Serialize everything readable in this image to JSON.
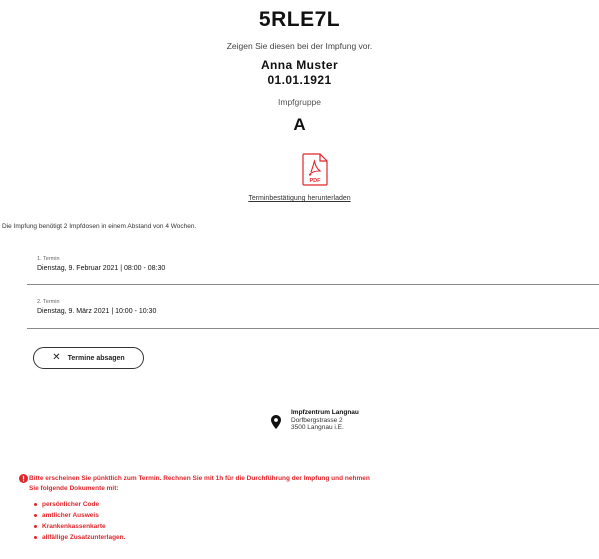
{
  "appointment": {
    "code": "5RLE7L",
    "code_hint": "Zeigen Sie diesen bei der Impfung vor.",
    "person_name": "Anna Muster",
    "birth_date": "01.01.1921",
    "group_label": "Impfgruppe",
    "group_value": "A"
  },
  "download": {
    "icon": "pdf-file-icon",
    "icon_text": "PDF",
    "link_label": "Terminbestätigung herunterladen"
  },
  "doses_info": "Die Impfung benötigt 2 Impfdosen in einem Abstand von 4 Wochen.",
  "termine": [
    {
      "label": "1. Termin",
      "datetime": "Dienstag, 9. Februar 2021 | 08:00 - 08:30"
    },
    {
      "label": "2. Termin",
      "datetime": "Dienstag, 9. März 2021 | 10:00 - 10:30"
    }
  ],
  "cancel_button": {
    "icon": "close-icon",
    "label": "Termine absagen"
  },
  "location": {
    "icon": "map-pin-icon",
    "name": "Impfzentrum Langnau",
    "street": "Dorfbergstrasse 2",
    "city": "3500 Langnau i.E."
  },
  "notice": {
    "icon": "alert-circle-icon",
    "color": "#e0262c",
    "text_line1": "Bitte erscheinen Sie pünktlich zum Termin. Rechnen Sie mit 1h für die Durchführung der Impfung und nehmen",
    "text_line2": "Sie folgende Dokumente mit:",
    "items": [
      "persönlicher Code",
      "amtlicher Ausweis",
      "Krankenkassenkarte",
      "allfällige Zusatzunterlagen."
    ]
  }
}
